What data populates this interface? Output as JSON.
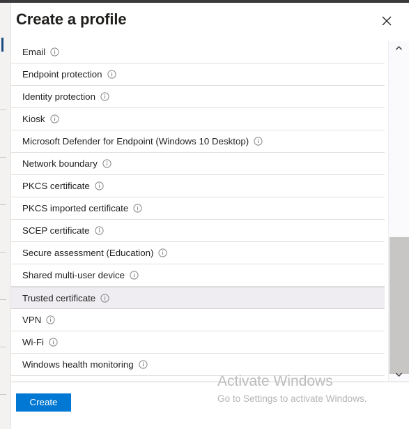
{
  "window": {
    "title": "Create a profile",
    "close_icon": "close-icon"
  },
  "scrollbar": {
    "up_arrow": "˄",
    "down_arrow": "˅"
  },
  "list": {
    "info_icon_name": "info-icon",
    "items": [
      {
        "label": "Email",
        "selected": false
      },
      {
        "label": "Endpoint protection",
        "selected": false
      },
      {
        "label": "Identity protection",
        "selected": false
      },
      {
        "label": "Kiosk",
        "selected": false
      },
      {
        "label": "Microsoft Defender for Endpoint (Windows 10 Desktop)",
        "selected": false
      },
      {
        "label": "Network boundary",
        "selected": false
      },
      {
        "label": "PKCS certificate",
        "selected": false
      },
      {
        "label": "PKCS imported certificate",
        "selected": false
      },
      {
        "label": "SCEP certificate",
        "selected": false
      },
      {
        "label": "Secure assessment (Education)",
        "selected": false
      },
      {
        "label": "Shared multi-user device",
        "selected": false
      },
      {
        "label": "Trusted certificate",
        "selected": true
      },
      {
        "label": "VPN",
        "selected": false
      },
      {
        "label": "Wi-Fi",
        "selected": false
      },
      {
        "label": "Windows health monitoring",
        "selected": false
      }
    ]
  },
  "footer": {
    "create_label": "Create"
  },
  "watermark": {
    "title": "Activate Windows",
    "subtitle": "Go to Settings to activate Windows."
  },
  "colors": {
    "accent": "#0078d4",
    "selected_row": "#efedf1",
    "divider": "#e1dfdd",
    "scrollbar_thumb": "#c8c6c4",
    "title_text": "#201f1e"
  }
}
